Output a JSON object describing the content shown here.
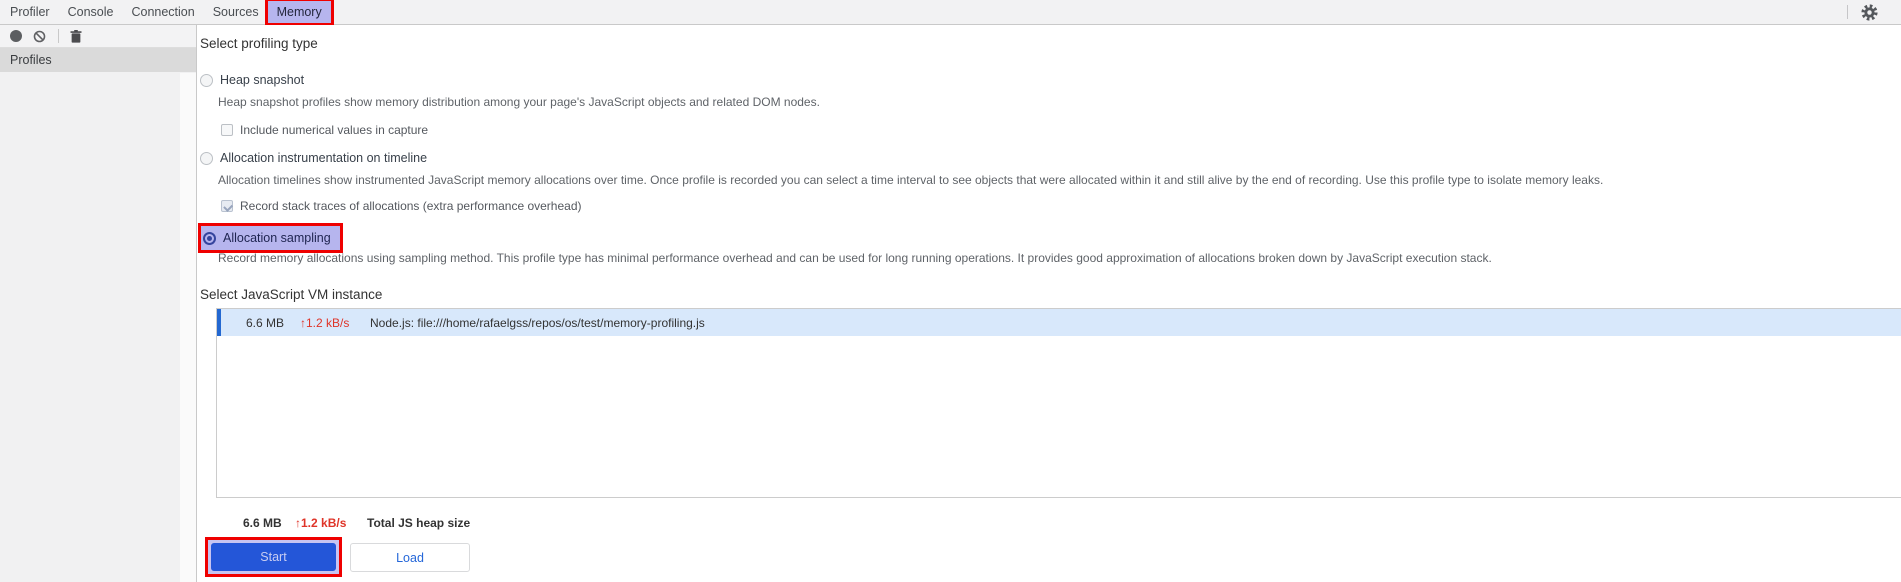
{
  "tabbar": {
    "tabs": [
      {
        "label": "Profiler"
      },
      {
        "label": "Console"
      },
      {
        "label": "Connection"
      },
      {
        "label": "Sources"
      },
      {
        "label": "Memory",
        "active": true,
        "annotated": true
      }
    ]
  },
  "toolbar": {
    "icons": [
      {
        "name": "record-icon"
      },
      {
        "name": "clear-icon"
      },
      {
        "name": "trash-icon"
      }
    ]
  },
  "sidebar": {
    "items": [
      {
        "label": "Profiles",
        "selected": true
      }
    ]
  },
  "main": {
    "profiling_heading": "Select profiling type",
    "options": [
      {
        "label": "Heap snapshot",
        "selected": false,
        "description": "Heap snapshot profiles show memory distribution among your page's JavaScript objects and related DOM nodes.",
        "checkbox": {
          "label": "Include numerical values in capture",
          "checked": false
        }
      },
      {
        "label": "Allocation instrumentation on timeline",
        "selected": false,
        "description": "Allocation timelines show instrumented JavaScript memory allocations over time. Once profile is recorded you can select a time interval to see objects that were allocated within it and still alive by the end of recording. Use this profile type to isolate memory leaks.",
        "checkbox": {
          "label": "Record stack traces of allocations (extra performance overhead)",
          "checked": true,
          "disabled": true
        }
      },
      {
        "label": "Allocation sampling",
        "selected": true,
        "annotated": true,
        "description": "Record memory allocations using sampling method. This profile type has minimal performance overhead and can be used for long running operations. It provides good approximation of allocations broken down by JavaScript execution stack."
      }
    ],
    "vm_heading": "Select JavaScript VM instance",
    "vm_list": {
      "rows": [
        {
          "heap_size": "6.6 MB",
          "rate": "↑1.2 kB/s",
          "name": "Node.js: file:///home/rafaelgss/repos/os/test/memory-profiling.js",
          "selected": true
        }
      ]
    },
    "totals": {
      "heap_size": "6.6 MB",
      "rate": "↑1.2 kB/s",
      "label": "Total JS heap size"
    },
    "actions": {
      "start_label": "Start",
      "load_label": "Load"
    }
  },
  "colors": {
    "annotation_red": "#ef0000",
    "highlight_lavender": "#b6b5ee",
    "primary_button_blue": "#2456d8",
    "link_blue": "#2567d9",
    "status_red": "#df3428",
    "row_selected_bg": "#d8e8fb",
    "row_accent_blue": "#2368d1"
  }
}
